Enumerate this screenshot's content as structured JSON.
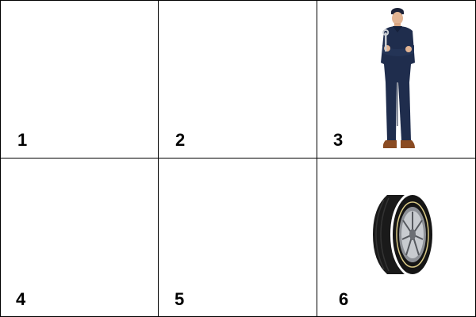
{
  "cells": [
    {
      "label": "1",
      "image": ""
    },
    {
      "label": "2",
      "image": ""
    },
    {
      "label": "3",
      "image": "mechanic-figure"
    },
    {
      "label": "4",
      "image": ""
    },
    {
      "label": "5",
      "image": ""
    },
    {
      "label": "6",
      "image": "tire-image"
    }
  ],
  "colors": {
    "grid_line": "#000000",
    "background": "#ffffff",
    "coverall": "#1f2d4d",
    "tire_rubber": "#1a1a1a"
  }
}
